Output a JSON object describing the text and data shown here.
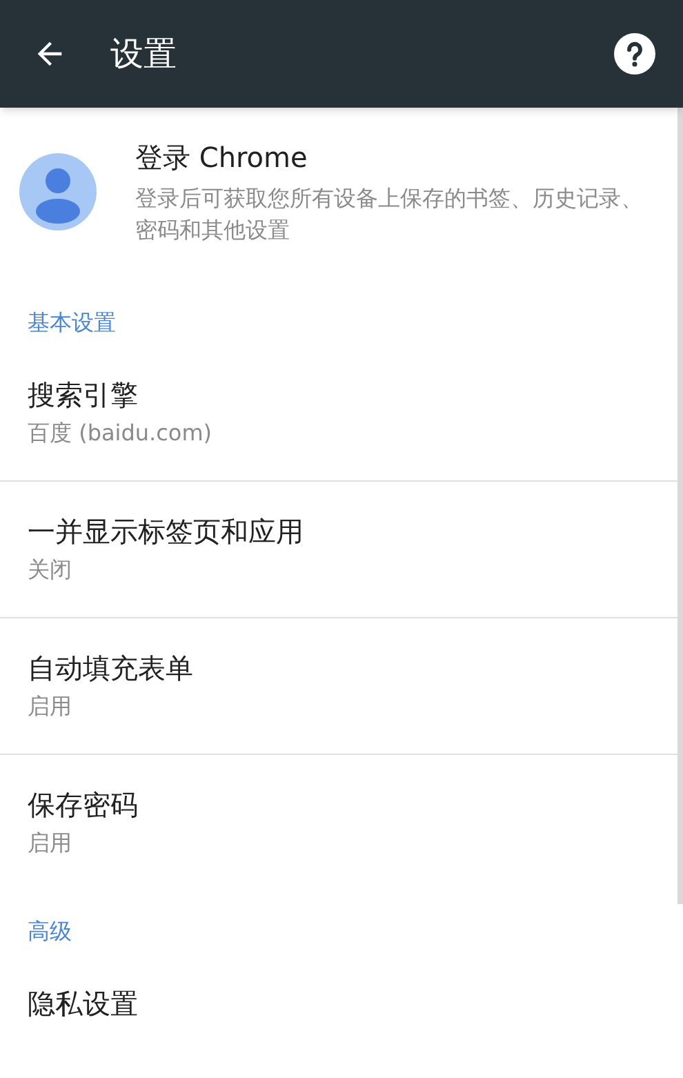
{
  "app_bar": {
    "title": "设置"
  },
  "account": {
    "title": "登录 Chrome",
    "description": "登录后可获取您所有设备上保存的书签、历史记录、密码和其他设置"
  },
  "sections": [
    {
      "header": "基本设置",
      "items": [
        {
          "title": "搜索引擎",
          "subtitle": "百度 (baidu.com)"
        },
        {
          "title": "一并显示标签页和应用",
          "subtitle": "关闭"
        },
        {
          "title": "自动填充表单",
          "subtitle": "启用"
        },
        {
          "title": "保存密码",
          "subtitle": "启用"
        }
      ]
    },
    {
      "header": "高级",
      "items": [
        {
          "title": "隐私设置"
        }
      ]
    }
  ]
}
